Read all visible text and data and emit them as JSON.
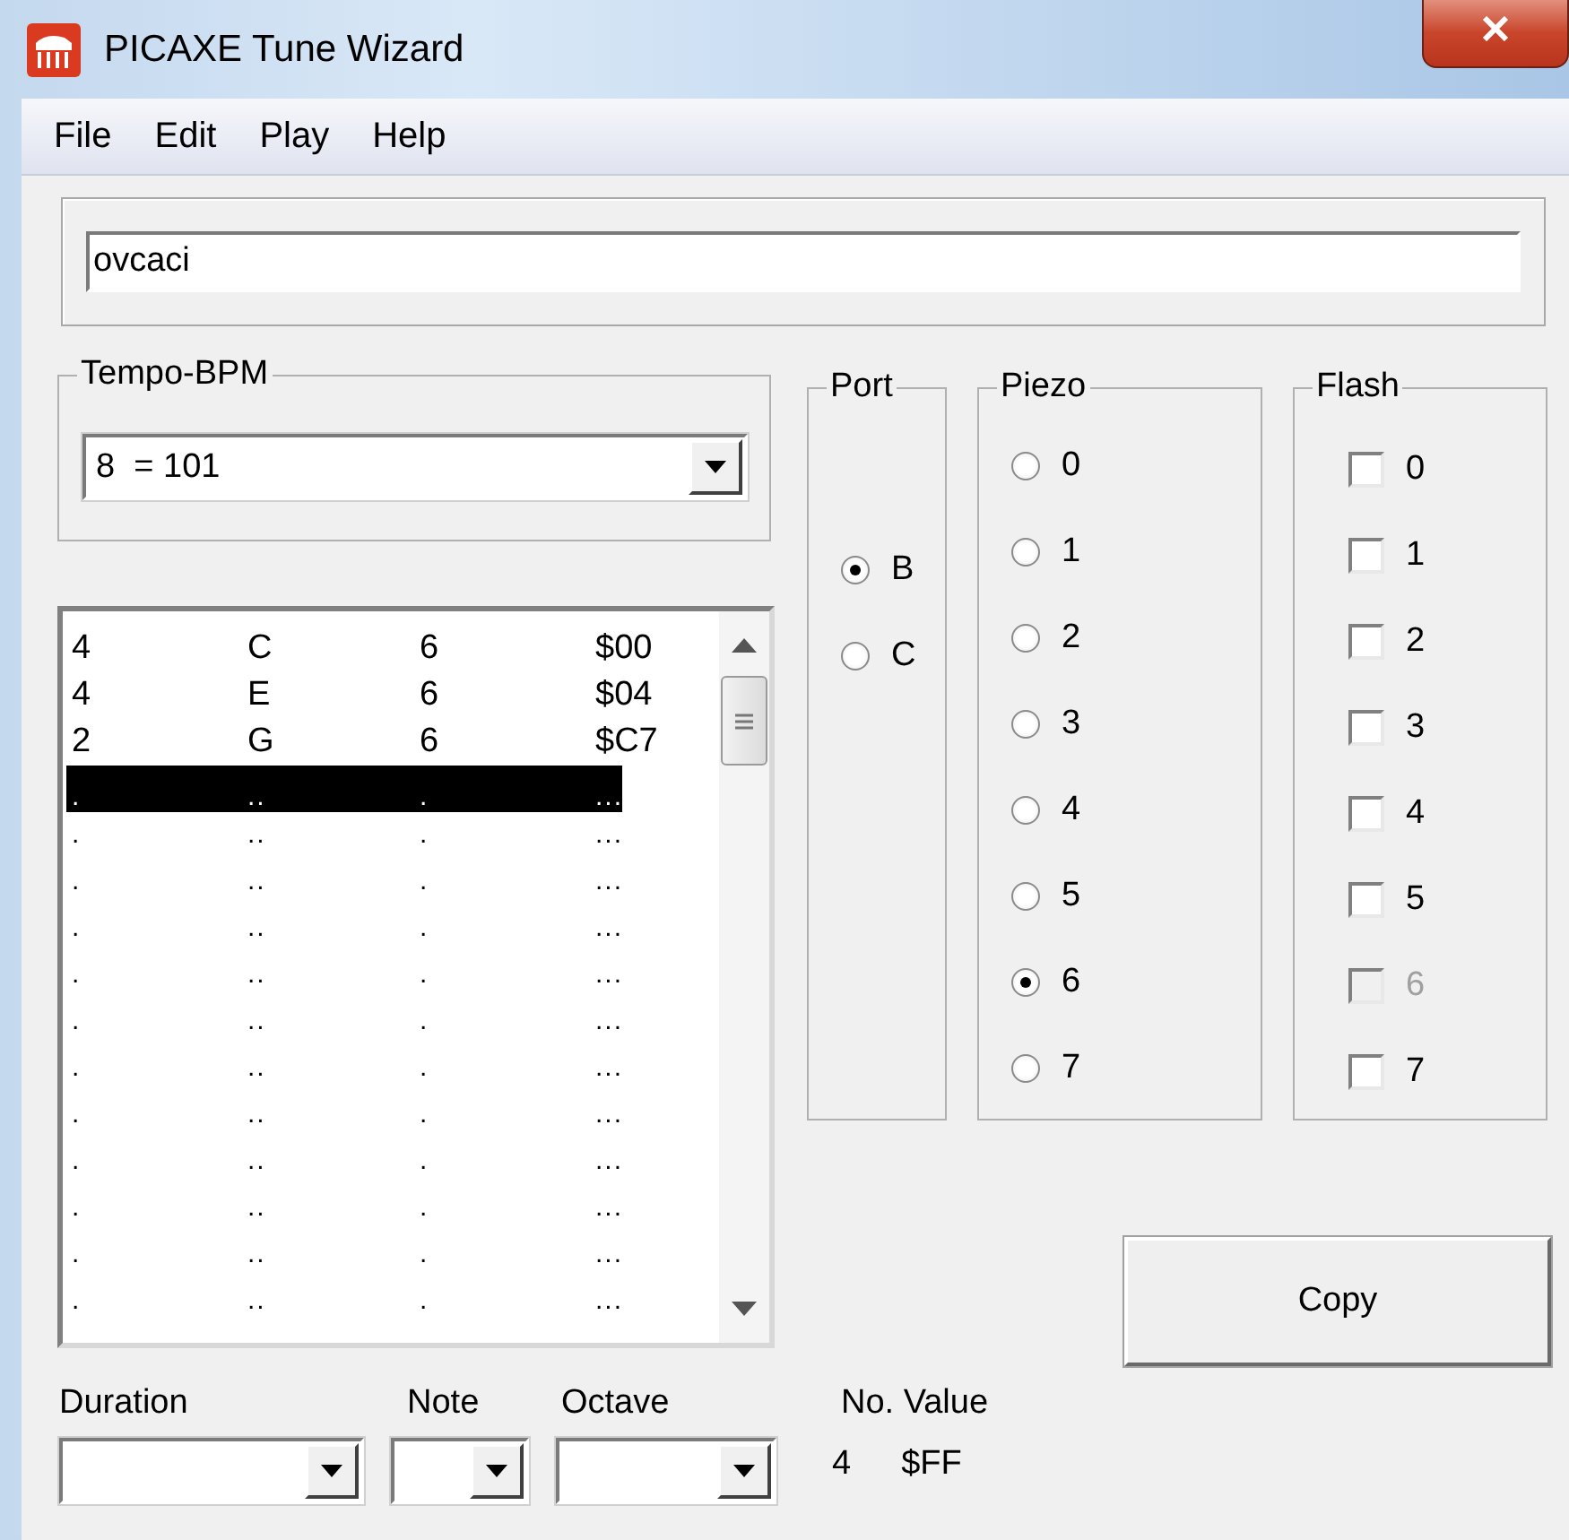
{
  "window": {
    "title": "PICAXE Tune Wizard"
  },
  "menu": [
    {
      "label": "File"
    },
    {
      "label": "Edit"
    },
    {
      "label": "Play"
    },
    {
      "label": "Help"
    }
  ],
  "tune_name": {
    "value": "ovcaci"
  },
  "tempo": {
    "label": "Tempo-BPM",
    "value": "8  = 101"
  },
  "notes_list": {
    "rows": [
      {
        "cells": [
          "4",
          "C",
          "6",
          "$00"
        ],
        "selected": false
      },
      {
        "cells": [
          "4",
          "E",
          "6",
          "$04"
        ],
        "selected": false
      },
      {
        "cells": [
          "2",
          "G",
          "6",
          "$C7"
        ],
        "selected": false
      },
      {
        "cells": [
          ".",
          "..",
          ".",
          "..."
        ],
        "selected": true
      },
      {
        "cells": [
          ".",
          "..",
          ".",
          "..."
        ],
        "selected": false
      },
      {
        "cells": [
          ".",
          "..",
          ".",
          "..."
        ],
        "selected": false
      },
      {
        "cells": [
          ".",
          "..",
          ".",
          "..."
        ],
        "selected": false
      },
      {
        "cells": [
          ".",
          "..",
          ".",
          "..."
        ],
        "selected": false
      },
      {
        "cells": [
          ".",
          "..",
          ".",
          "..."
        ],
        "selected": false
      },
      {
        "cells": [
          ".",
          "..",
          ".",
          "..."
        ],
        "selected": false
      },
      {
        "cells": [
          ".",
          "..",
          ".",
          "..."
        ],
        "selected": false
      },
      {
        "cells": [
          ".",
          "..",
          ".",
          "..."
        ],
        "selected": false
      },
      {
        "cells": [
          ".",
          "..",
          ".",
          "..."
        ],
        "selected": false
      },
      {
        "cells": [
          ".",
          "..",
          ".",
          "..."
        ],
        "selected": false
      },
      {
        "cells": [
          ".",
          "..",
          ".",
          "..."
        ],
        "selected": false
      }
    ]
  },
  "port": {
    "label": "Port",
    "options": [
      {
        "label": "B",
        "selected": true
      },
      {
        "label": "C",
        "selected": false
      }
    ]
  },
  "piezo": {
    "label": "Piezo",
    "options": [
      {
        "label": "0",
        "selected": false
      },
      {
        "label": "1",
        "selected": false
      },
      {
        "label": "2",
        "selected": false
      },
      {
        "label": "3",
        "selected": false
      },
      {
        "label": "4",
        "selected": false
      },
      {
        "label": "5",
        "selected": false
      },
      {
        "label": "6",
        "selected": true
      },
      {
        "label": "7",
        "selected": false
      }
    ]
  },
  "flash": {
    "label": "Flash",
    "options": [
      {
        "label": "0",
        "checked": false,
        "disabled": false
      },
      {
        "label": "1",
        "checked": false,
        "disabled": false
      },
      {
        "label": "2",
        "checked": false,
        "disabled": false
      },
      {
        "label": "3",
        "checked": false,
        "disabled": false
      },
      {
        "label": "4",
        "checked": false,
        "disabled": false
      },
      {
        "label": "5",
        "checked": false,
        "disabled": false
      },
      {
        "label": "6",
        "checked": false,
        "disabled": true
      },
      {
        "label": "7",
        "checked": false,
        "disabled": false
      }
    ]
  },
  "copy_button": {
    "label": "Copy"
  },
  "duration": {
    "label": "Duration"
  },
  "note": {
    "label": "Note"
  },
  "octave": {
    "label": "Octave"
  },
  "no_value": {
    "label": "No. Value",
    "number": "4",
    "value": "$FF"
  }
}
